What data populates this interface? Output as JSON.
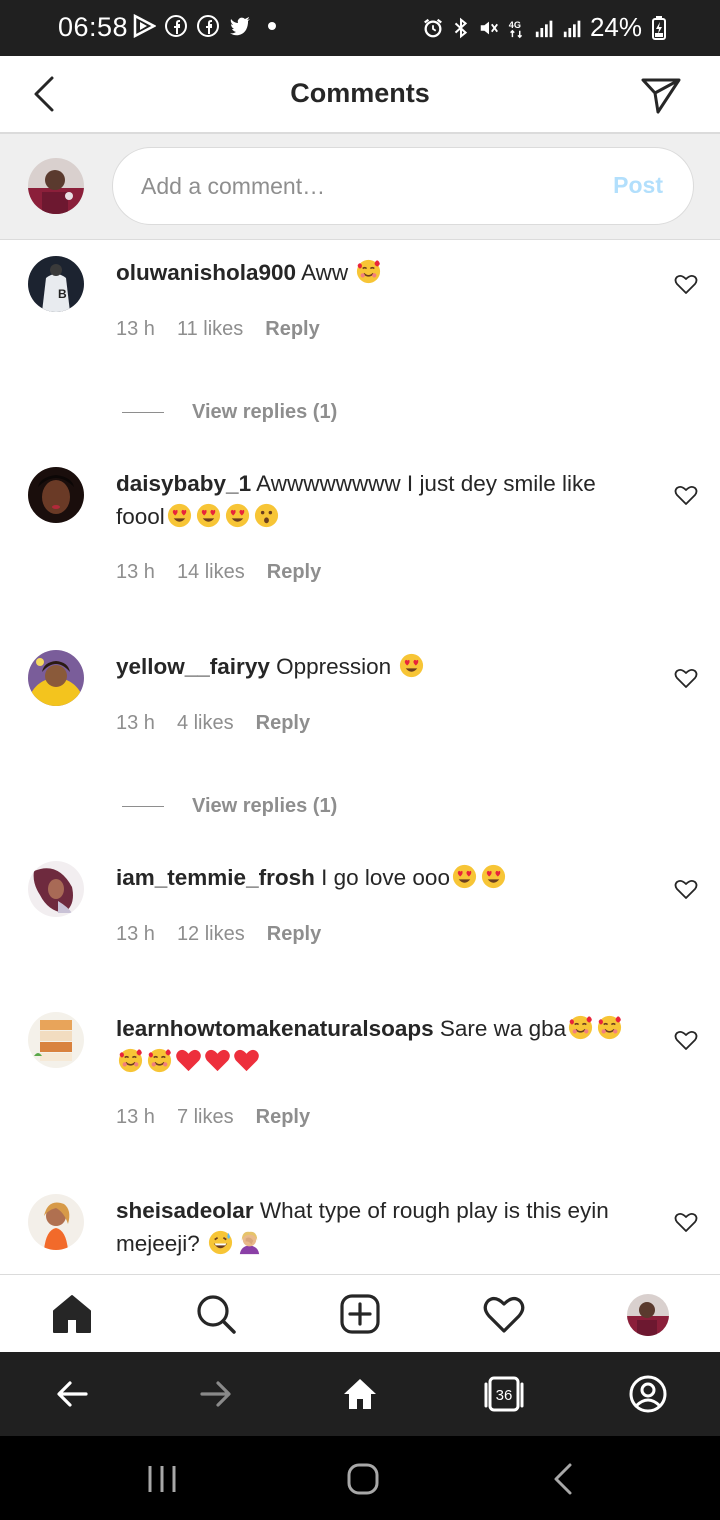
{
  "status_bar": {
    "time": "06:58",
    "battery": "24%",
    "network": "4G",
    "left_icons": [
      "play-icon",
      "facebook-icon",
      "facebook-icon",
      "twitter-icon",
      "dot-icon"
    ],
    "right_icons": [
      "alarm-icon",
      "bluetooth-icon",
      "mute-icon",
      "signal-icon",
      "signal-icon",
      "battery-icon"
    ]
  },
  "header": {
    "title": "Comments"
  },
  "composer": {
    "placeholder": "Add a comment…",
    "post_label": "Post"
  },
  "comments": [
    {
      "username": "oluwanishola900",
      "text": "Aww",
      "emojis": [
        "smiling-hearts"
      ],
      "time": "13 h",
      "likes": "11 likes",
      "reply": "Reply",
      "view_replies": "View replies (1)"
    },
    {
      "username": "daisybaby_1",
      "text": "Awwwwwwww I just dey smile like foool",
      "emojis": [
        "heart-eyes",
        "heart-eyes",
        "heart-eyes",
        "astonished"
      ],
      "time": "13 h",
      "likes": "14 likes",
      "reply": "Reply"
    },
    {
      "username": "yellow__fairyy",
      "text": "Oppression",
      "emojis": [
        "heart-eyes"
      ],
      "time": "13 h",
      "likes": "4 likes",
      "reply": "Reply",
      "view_replies": "View replies (1)"
    },
    {
      "username": "iam_temmie_frosh",
      "text": "I go love ooo",
      "emojis": [
        "heart-eyes",
        "heart-eyes"
      ],
      "time": "13 h",
      "likes": "12 likes",
      "reply": "Reply"
    },
    {
      "username": "learnhowtomakenaturalsoaps",
      "text": "Sare wa gba",
      "emojis": [
        "smiling-hearts",
        "smiling-hearts",
        "smiling-hearts",
        "smiling-hearts",
        "red-heart",
        "red-heart",
        "red-heart"
      ],
      "time": "13 h",
      "likes": "7 likes",
      "reply": "Reply"
    },
    {
      "username": "sheisadeolar",
      "text": "What type of rough play is this eyin mejeeji?",
      "emojis": [
        "grinning-sweat",
        "woman-facepalming"
      ]
    }
  ],
  "bottom_nav": [
    "home-icon",
    "search-icon",
    "new-post-icon",
    "activity-heart-icon",
    "profile-avatar"
  ],
  "browser_bar": {
    "tab_count": "36",
    "items": [
      "back-arrow-icon",
      "forward-arrow-icon",
      "home-icon",
      "tabs-icon",
      "account-icon"
    ]
  },
  "colors": {
    "status_bar_bg": "#202020",
    "post_disabled": "#b2dffc",
    "secondary_text": "#8e8e8e",
    "red_heart": "#ed2f3c"
  }
}
